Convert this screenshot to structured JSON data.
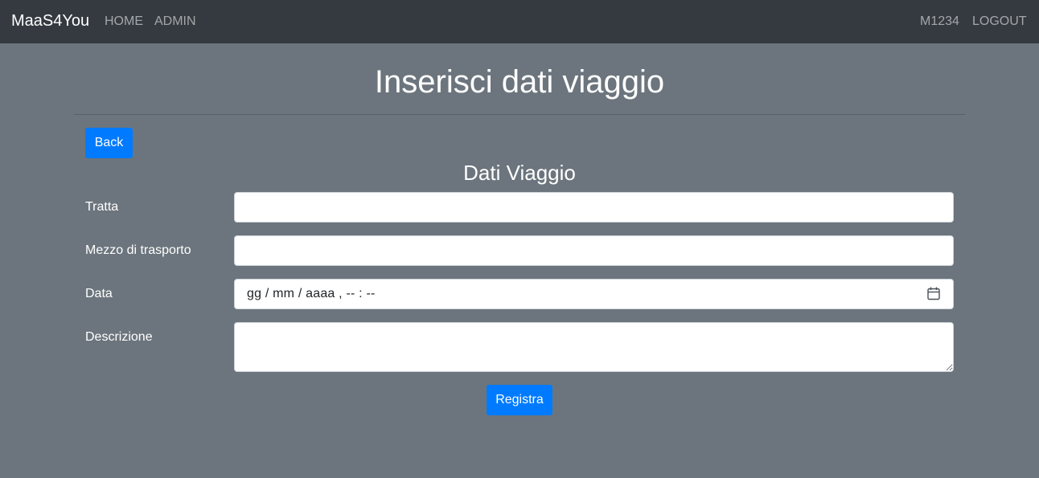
{
  "navbar": {
    "brand": "MaaS4You",
    "links": [
      "HOME",
      "ADMIN"
    ],
    "user": "M1234",
    "logout": "LOGOUT"
  },
  "page": {
    "title": "Inserisci dati viaggio",
    "back_label": "Back"
  },
  "form": {
    "section_title": "Dati Viaggio",
    "fields": {
      "tratta": {
        "label": "Tratta",
        "value": ""
      },
      "mezzo": {
        "label": "Mezzo di trasporto",
        "value": ""
      },
      "data": {
        "label": "Data",
        "display": "gg / mm / aaaa ,  -- : --"
      },
      "descrizione": {
        "label": "Descrizione",
        "value": ""
      }
    },
    "submit_label": "Registra"
  },
  "colors": {
    "navbar_bg": "#343a40",
    "page_bg": "#6c757d",
    "primary": "#007bff"
  },
  "icons": {
    "date_picker": "calendar-icon"
  }
}
